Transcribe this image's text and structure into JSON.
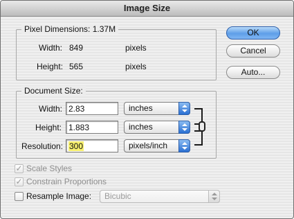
{
  "window": {
    "title": "Image Size"
  },
  "pixel_dimensions": {
    "title": "Pixel Dimensions:",
    "size": "1.37M",
    "width_label": "Width:",
    "width_value": "849",
    "width_unit": "pixels",
    "height_label": "Height:",
    "height_value": "565",
    "height_unit": "pixels"
  },
  "document_size": {
    "title": "Document Size:",
    "width_label": "Width:",
    "width_value": "2.83",
    "width_unit": "inches",
    "height_label": "Height:",
    "height_value": "1.883",
    "height_unit": "inches",
    "resolution_label": "Resolution:",
    "resolution_value": "300",
    "resolution_unit": "pixels/inch",
    "link_icon": "chain-link-icon"
  },
  "buttons": {
    "ok": "OK",
    "cancel": "Cancel",
    "auto": "Auto..."
  },
  "options": {
    "scale_styles": {
      "label": "Scale Styles",
      "checked": true,
      "enabled": false
    },
    "constrain_proportions": {
      "label": "Constrain Proportions",
      "checked": true,
      "enabled": false
    },
    "resample_image": {
      "label": "Resample Image:",
      "checked": false,
      "method": "Bicubic"
    }
  },
  "colors": {
    "default_button": "#5e9ee8",
    "highlight": "#f7f06f"
  }
}
